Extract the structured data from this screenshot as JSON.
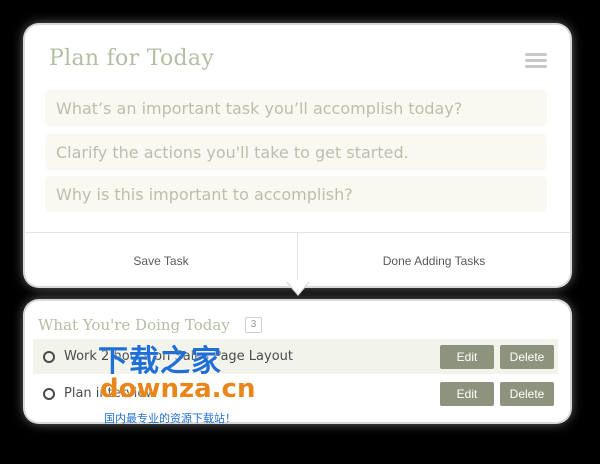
{
  "plan_panel": {
    "title": "Plan for Today",
    "inputs": [
      {
        "placeholder": "What’s an important task you’ll accomplish today?",
        "value": ""
      },
      {
        "placeholder": "Clarify the actions you'll take to get started.",
        "value": ""
      },
      {
        "placeholder": "Why is this important to accomplish?",
        "value": ""
      }
    ],
    "save_label": "Save Task",
    "done_label": "Done Adding Tasks",
    "menu_icon": "hamburger-menu-icon"
  },
  "today_panel": {
    "title": "What You're Doing Today",
    "count": "3",
    "tasks": [
      {
        "text": "Work 2 hours on Sales Page Layout",
        "edit_label": "Edit",
        "delete_label": "Delete"
      },
      {
        "text": "Plan interview",
        "edit_label": "Edit",
        "delete_label": "Delete"
      }
    ]
  },
  "watermark": {
    "title": "下载之家",
    "domain": "downza.cn",
    "tagline": "国内最专业的资源下载站！"
  },
  "colors": {
    "title_green": "#b3bea2",
    "button_bg": "#8d937d",
    "input_bg": "#f9f9f2",
    "row_highlight": "#f2f4ec"
  }
}
